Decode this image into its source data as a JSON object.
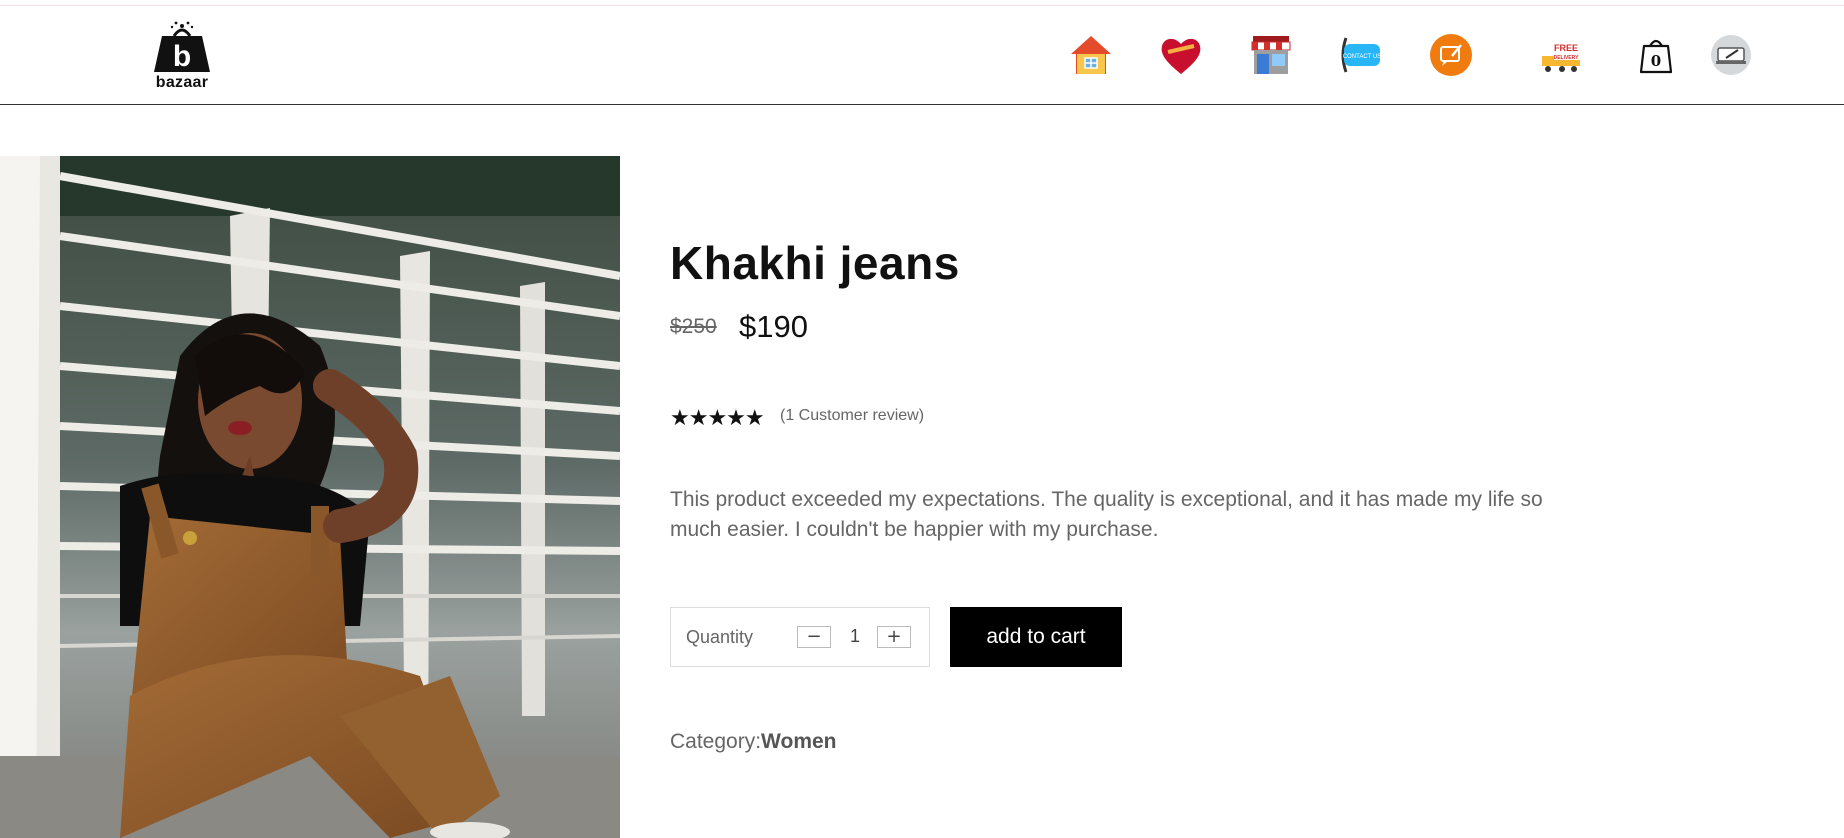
{
  "brand": {
    "name": "bazaar"
  },
  "nav": {
    "home": "home-icon",
    "favorites": "heart-icon",
    "shop": "store-icon",
    "contact": "CONTACT US",
    "feedback": "feedback-icon",
    "delivery_line1": "FREE",
    "delivery_line2": "DELIVERY",
    "cart_count": "0",
    "profile": "avatar-icon"
  },
  "product": {
    "title": "Khakhi jeans",
    "old_price": "$250",
    "price": "$190",
    "stars": "★★★★★",
    "rating": 5,
    "reviews": "(1 Customer review)",
    "description": "This product exceeded my expectations. The quality is exceptional, and it has made my life so much easier. I couldn't be happier with my purchase.",
    "quantity_label": "Quantity",
    "quantity": "1",
    "minus": "−",
    "plus": "+",
    "add_to_cart": "add to cart",
    "category_label": "Category:",
    "category": "Women"
  },
  "colors": {
    "primary": "#000000",
    "muted_text": "#666666",
    "accent_orange": "#f07c10",
    "accent_red": "#c8102e"
  }
}
